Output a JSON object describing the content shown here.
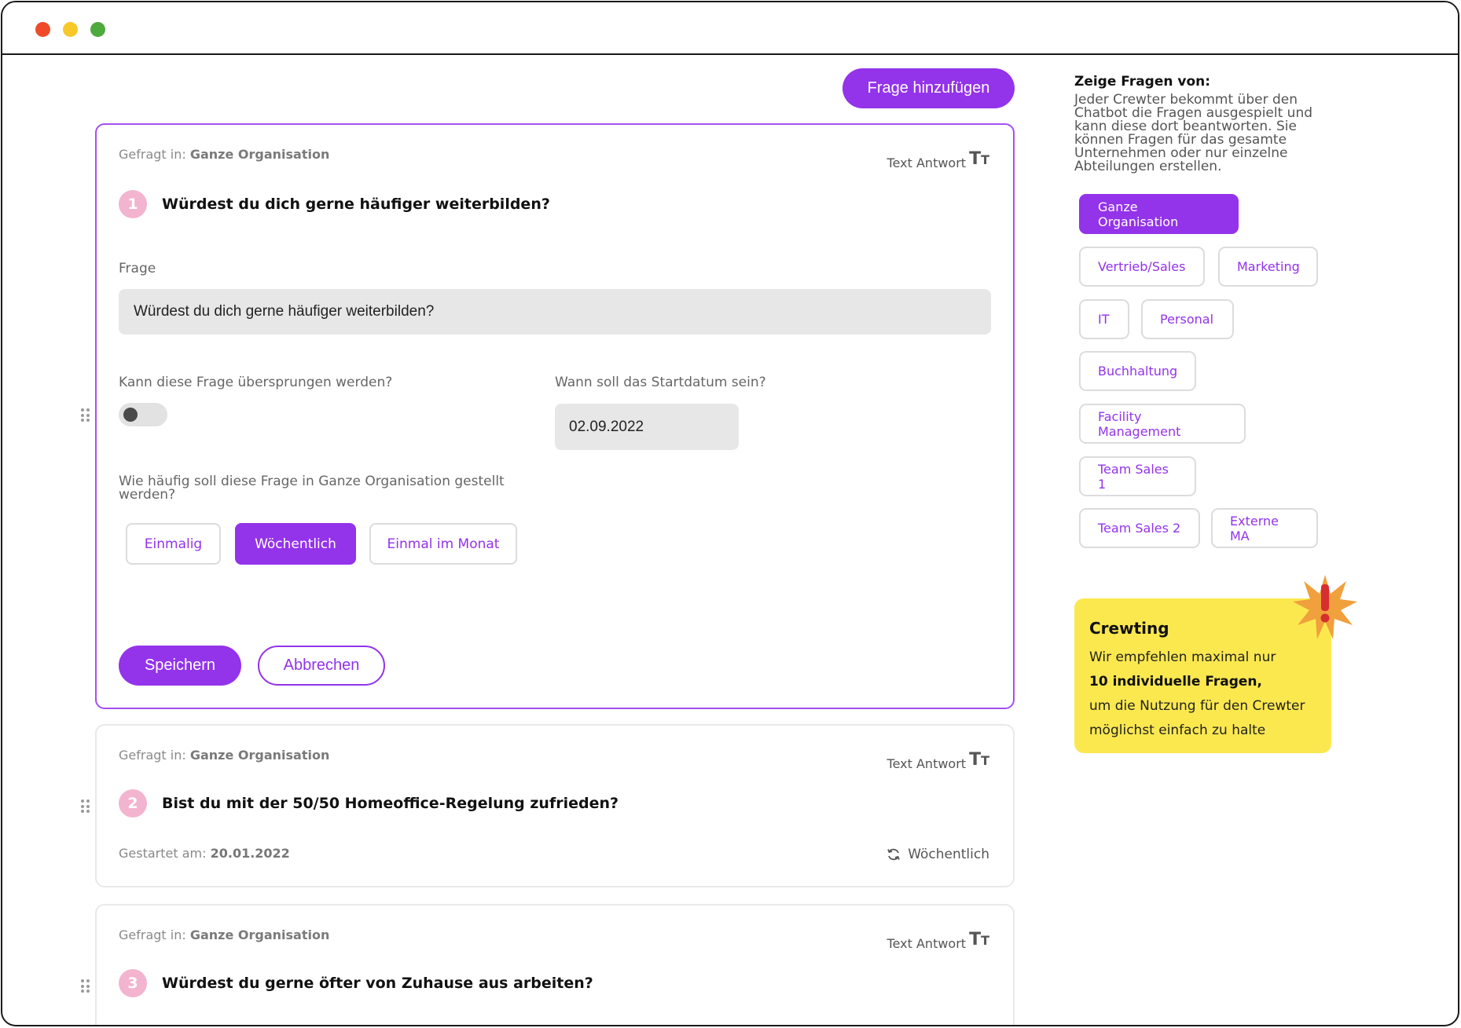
{
  "questions": [
    {
      "asked_in_label": "Gefragt in:",
      "asked_in_value": "Ganze Organisation",
      "answer_type": "Text Antwort",
      "number": "1",
      "title": "Würdest du dich gerne häufiger weiterbilden?",
      "edit": {
        "question_label": "Frage",
        "question_value": "Würdest du dich gerne häufiger weiterbilden?",
        "skip_label": "Kann diese Frage übersprungen werden?",
        "skip_enabled": false,
        "start_date_label": "Wann soll das Startdatum sein?",
        "start_date_value": "02.09.2022",
        "frequency_label": "Wie häufig soll diese Frage in Ganze Organisation gestellt werden?",
        "frequency_options": [
          "Einmalig",
          "Wöchentlich",
          "Einmal im Monat"
        ],
        "frequency_selected": "Wöchentlich",
        "save_label": "Speichern",
        "cancel_label": "Abbrechen"
      }
    },
    {
      "asked_in_label": "Gefragt in:",
      "asked_in_value": "Ganze Organisation",
      "answer_type": "Text Antwort",
      "number": "2",
      "title": "Bist du mit der 50/50 Homeoffice-Regelung zufrieden?",
      "started_label": "Gestartet am:",
      "started_value": "20.01.2022",
      "recurrence": "Wöchentlich"
    },
    {
      "asked_in_label": "Gefragt in:",
      "asked_in_value": "Ganze Organisation",
      "answer_type": "Text Antwort",
      "number": "3",
      "title": "Würdest du gerne öfter von Zuhause aus arbeiten?"
    }
  ],
  "toolbar": {
    "add_question_label": "Frage hinzufügen"
  },
  "sidebar": {
    "title": "Zeige Fragen von:",
    "description": "Jeder Crewter bekommt über den Chatbot die Fragen ausgespielt und kann diese dort beantworten. Sie können Fragen für das gesamte Unternehmen oder nur einzelne Abteilungen erstellen.",
    "departments": [
      "Ganze Organisation",
      "Vertrieb/Sales",
      "Marketing",
      "IT",
      "Personal",
      "Buchhaltung",
      "Facility Management",
      "Team Sales 1",
      "Team Sales 2",
      "Externe MA"
    ],
    "selected_department": "Ganze Organisation",
    "note": {
      "title": "Crewting",
      "line1": "Wir empfehlen maximal nur",
      "line2": "10 individuelle Fragen,",
      "line3": "um die Nutzung für den Crewter",
      "line4": "möglichst einfach zu halte"
    }
  },
  "icons": {
    "answer_type": "text-size-icon",
    "drag": "drag-handle-icon",
    "recurrence": "refresh-icon",
    "note_badge": "exclamation-burst-icon"
  },
  "colors": {
    "accent": "#9333ea",
    "note_bg": "#fbe84f",
    "number_badge": "#f3b4cf",
    "burst": "#f0a03c",
    "burst_mark": "#d62f2f"
  }
}
